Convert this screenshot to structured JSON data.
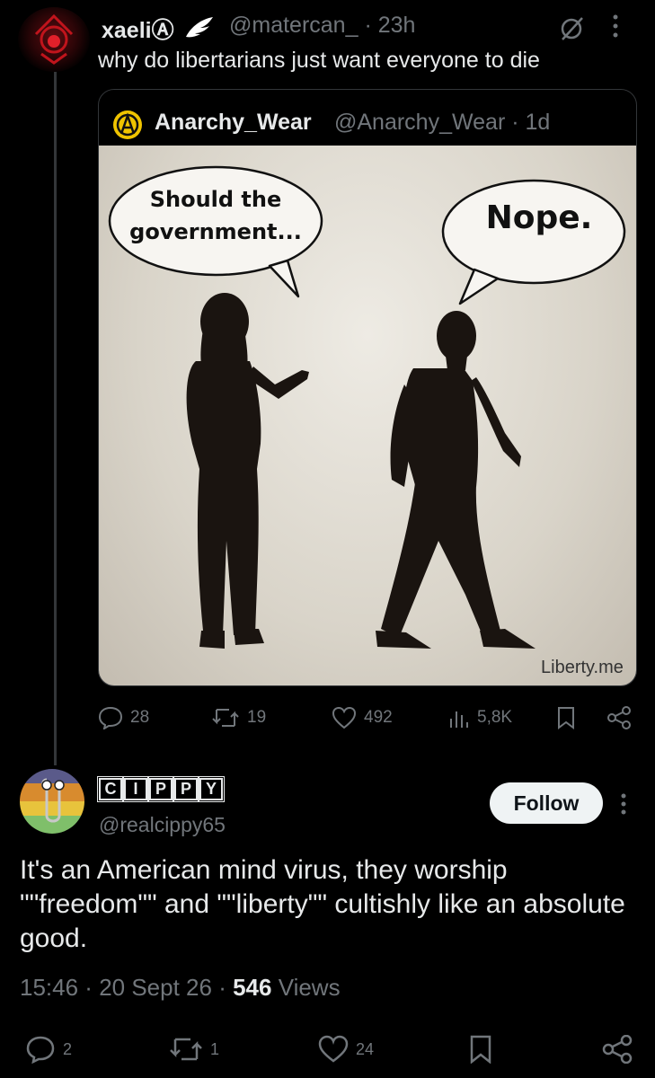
{
  "tweet": {
    "author_name": "xaeliⒶ",
    "handle": "@matercan_",
    "time": "23h",
    "text": "why do libertarians just want everyone to die"
  },
  "quote": {
    "author_name": "Anarchy_Wear",
    "handle": "@Anarchy_Wear",
    "time": "1d",
    "bubble_left": "Should the government...",
    "bubble_right": "Nope.",
    "watermark": "Liberty.me"
  },
  "tweet_actions": {
    "replies": "28",
    "reposts": "19",
    "likes": "492",
    "views": "5,8K"
  },
  "reply": {
    "author_letters": [
      "C",
      "I",
      "P",
      "P",
      "Y"
    ],
    "handle": "@realcippy65",
    "follow_label": "Follow",
    "text": "It's an American mind virus, they worship \"\"freedom\"\" and \"\"liberty\"\" cultishly like an absolute good.",
    "time": "15:46",
    "date": "20 Sept 26",
    "views_count": "546",
    "views_label": "Views"
  },
  "reply_actions": {
    "replies": "2",
    "reposts": "1",
    "likes": "24"
  },
  "colors": {
    "background": "#000000",
    "text": "#e7e9ea",
    "muted": "#71767b",
    "border": "#333639"
  }
}
